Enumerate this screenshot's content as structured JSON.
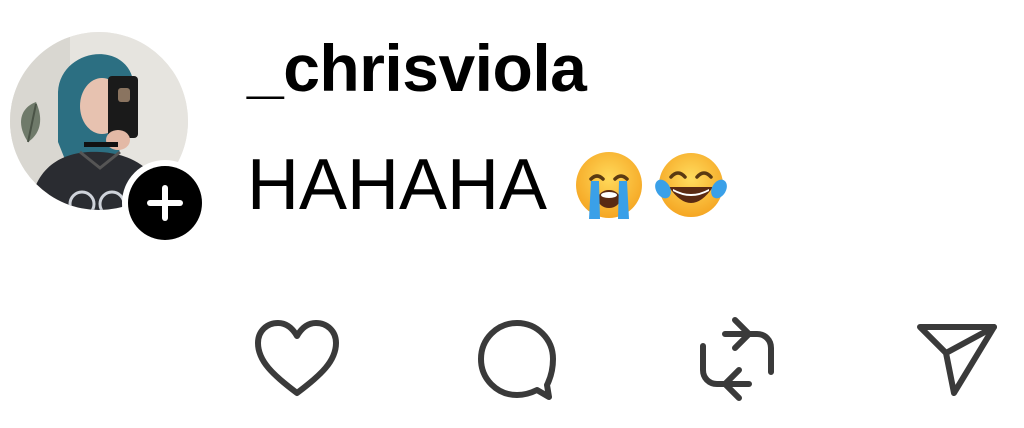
{
  "post": {
    "username": "_chrisviola",
    "text": "HAHAHA",
    "emojis": [
      "loudly-crying-face",
      "face-with-tears-of-joy"
    ]
  },
  "actions": {
    "icons": [
      "heart-icon",
      "comment-icon",
      "repost-icon",
      "share-icon"
    ]
  },
  "colors": {
    "text": "#000000",
    "icon": "#3a3a3a",
    "badge": "#000000",
    "background": "#ffffff"
  }
}
